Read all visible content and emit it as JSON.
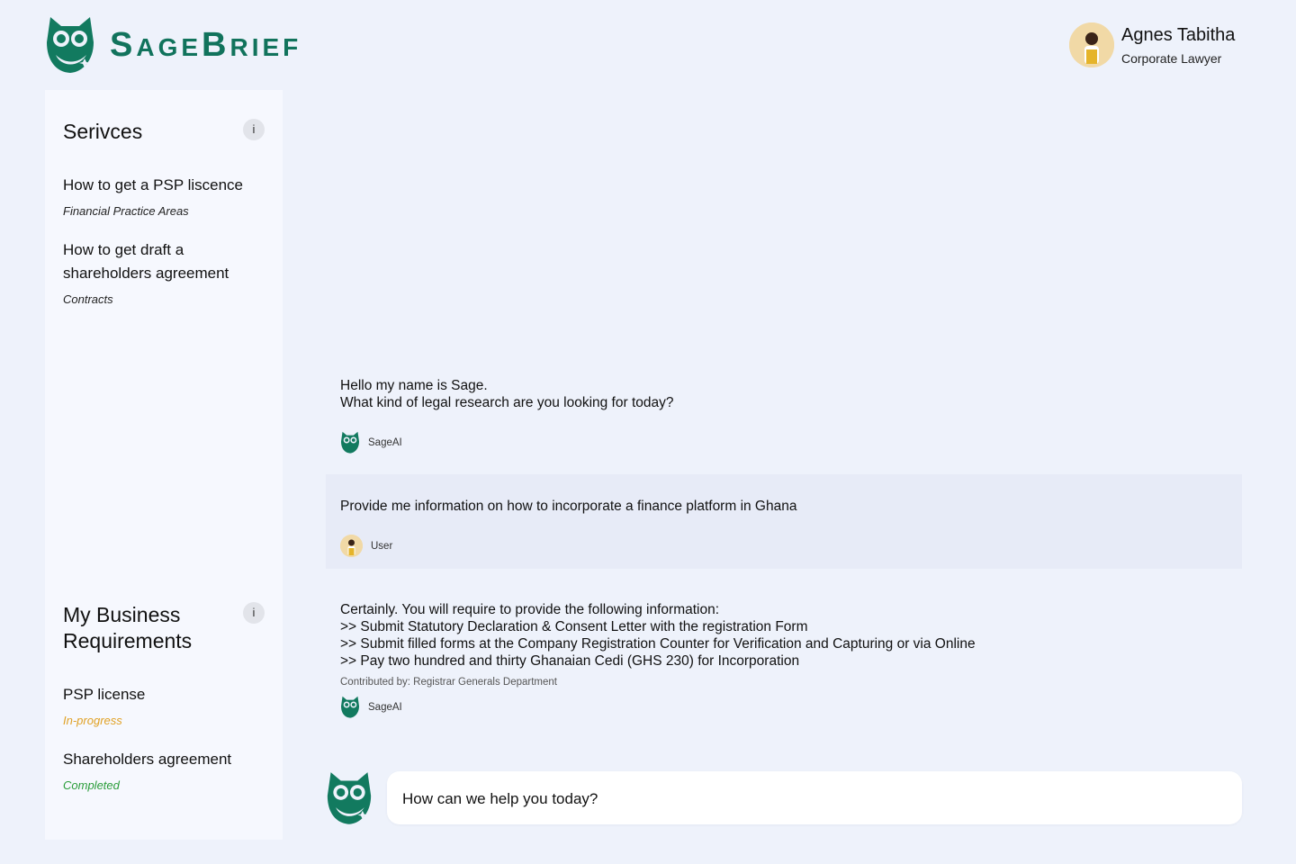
{
  "brand": {
    "name_initial_1": "S",
    "name_rest_1": "AGE",
    "name_initial_2": "B",
    "name_rest_2": "RIEF",
    "accent": "#11735c"
  },
  "user": {
    "name": "Agnes Tabitha",
    "role": "Corporate Lawyer"
  },
  "services": {
    "title": "Serivces",
    "info_icon": "i",
    "items": [
      {
        "title": "How to get a PSP liscence",
        "category": "Financial Practice Areas"
      },
      {
        "title": "How to get draft a shareholders agreement",
        "category": "Contracts"
      }
    ]
  },
  "requirements": {
    "title": "My Business Requirements",
    "info_icon": "i",
    "items": [
      {
        "title": "PSP license",
        "status": "In-progress",
        "status_color": "#e0a125"
      },
      {
        "title": "Shareholders agreement",
        "status": "Completed",
        "status_color": "#2a9d3a"
      }
    ]
  },
  "chat": {
    "messages": [
      {
        "lines": [
          "Hello my name is Sage.",
          "What kind of legal research are you looking for today?"
        ],
        "from": "SageAI"
      },
      {
        "lines": [
          "Provide me information on how to incorporate a finance platform in Ghana"
        ],
        "from": "User"
      },
      {
        "lines": [
          "Certainly. You will require to provide the following information:",
          ">> Submit Statutory Declaration & Consent Letter with the registration Form",
          ">> Submit filled forms at the Company Registration Counter for Verification and Capturing or via Online",
          ">> Pay two hundred and thirty Ghanaian Cedi (GHS 230) for Incorporation"
        ],
        "contributor": "Contributed by: Registrar Generals Department",
        "from": "SageAI"
      }
    ]
  },
  "composer": {
    "placeholder": "How can we help you today?"
  }
}
